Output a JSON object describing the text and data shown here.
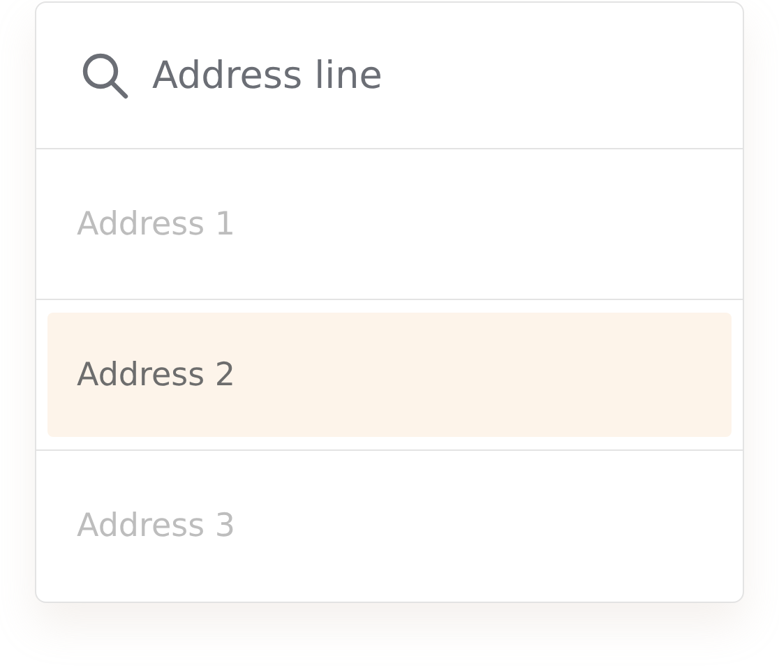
{
  "search": {
    "value": "Address line"
  },
  "options": [
    {
      "label": "Address 1",
      "selected": false
    },
    {
      "label": "Address 2",
      "selected": true
    },
    {
      "label": "Address 3",
      "selected": false
    }
  ]
}
